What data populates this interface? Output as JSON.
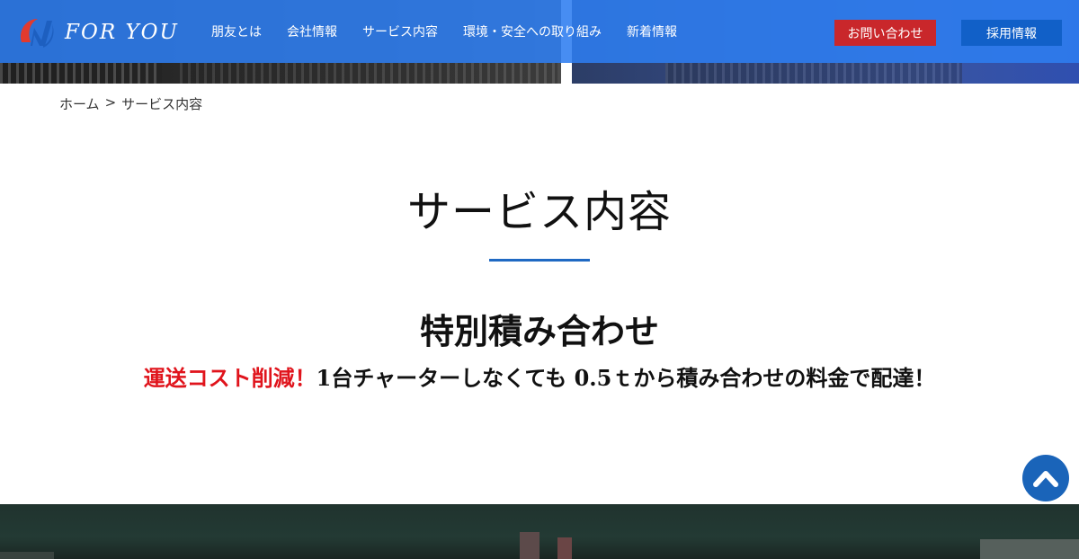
{
  "header": {
    "logo_text": "FOR YOU",
    "nav": [
      "朋友とは",
      "会社情報",
      "サービス内容",
      "環境・安全への取り組み",
      "新着情報"
    ],
    "contact_label": "お問い合わせ",
    "recruit_label": "採用情報",
    "accent": "#2e7df0"
  },
  "breadcrumb": {
    "home": "ホーム",
    "separator": ">",
    "current": "サービス内容"
  },
  "main": {
    "page_title": "サービス内容",
    "section_title": "特別積み合わせ",
    "tagline_red": "運送コスト削減！",
    "tagline_rest": "1台チャーターしなくても 0.5ｔから積み合わせの料金で配達！"
  },
  "colors": {
    "contact_button": "#c9272b",
    "recruit_button": "#1160c8",
    "title_rule": "#1f69c3",
    "tagline_highlight": "#e0141c"
  },
  "icons": {
    "logo": "for-you-logo-mark",
    "scroll_top": "chevron-up-icon"
  }
}
